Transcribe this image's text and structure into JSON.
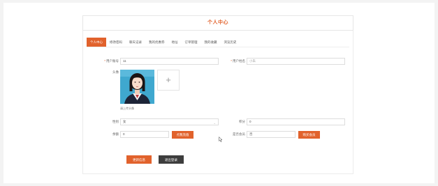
{
  "header": {
    "title": "个人中心"
  },
  "tabs": [
    {
      "label": "个人中心",
      "active": true
    },
    {
      "label": "修改密码",
      "active": false
    },
    {
      "label": "聊天记录",
      "active": false
    },
    {
      "label": "我的优惠券",
      "active": false
    },
    {
      "label": "地址",
      "active": false
    },
    {
      "label": "订单管理",
      "active": false
    },
    {
      "label": "我的收藏",
      "active": false
    },
    {
      "label": "浏览历史",
      "active": false
    }
  ],
  "form": {
    "account_label": "用户账号",
    "account_value": "11",
    "name_label": "用户姓名",
    "name_value": "小朱",
    "avatar_label": "头像",
    "upload_plus": "+",
    "avatar_hint": "请上传头像",
    "gender_label": "性别",
    "gender_value": "女",
    "points_label": "积分",
    "points_value": "0",
    "balance_label": "余额",
    "balance_value": "0",
    "recharge_button": "点我充值",
    "vip_label": "是否会员",
    "vip_value": "否",
    "buy_vip_button": "购买会员"
  },
  "actions": {
    "update_button": "更新信息",
    "logout_button": "退出登录"
  },
  "colors": {
    "accent": "#e1622c",
    "dark_button": "#3d3d3d"
  }
}
